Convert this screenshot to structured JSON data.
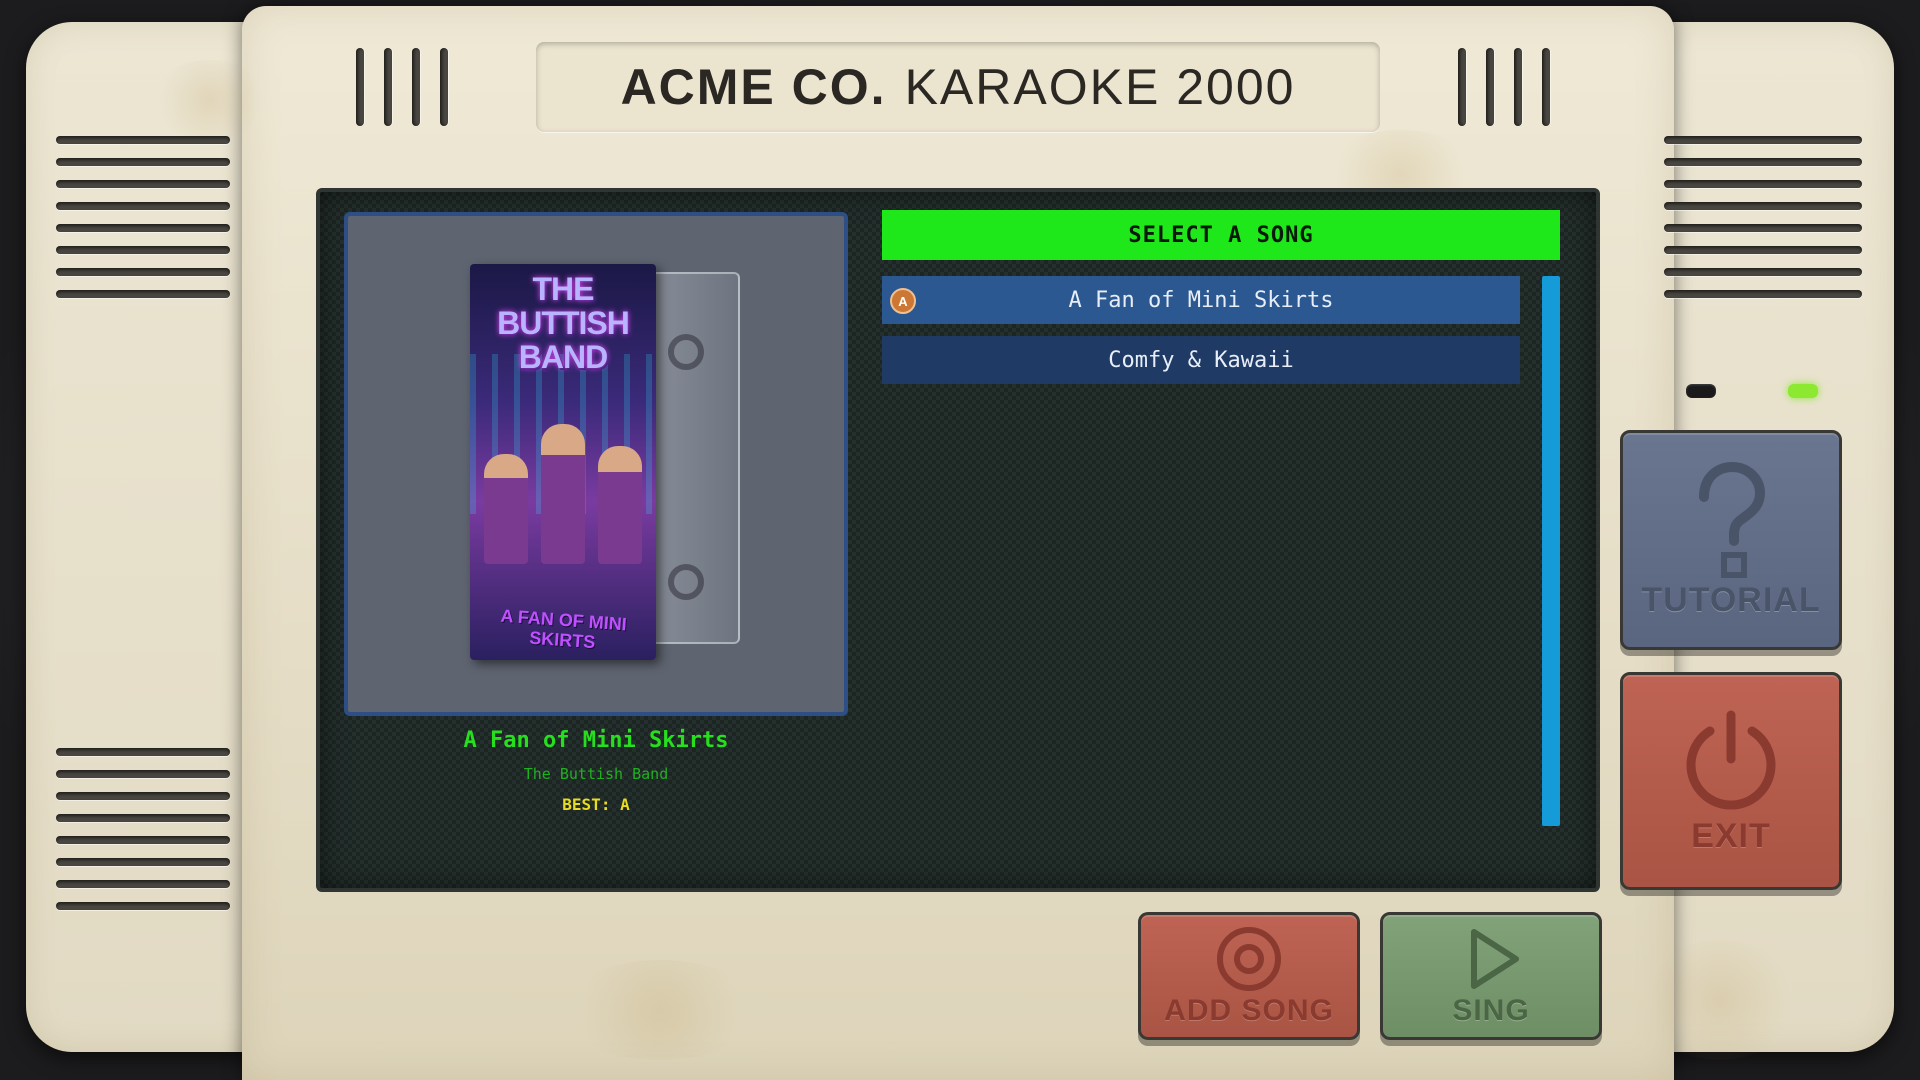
{
  "device": {
    "brand": "ACME CO.",
    "model": "KARAOKE 2000"
  },
  "now_playing": {
    "title": "A Fan of Mini Skirts",
    "artist": "The Buttish Band",
    "best": "BEST: A",
    "cover": {
      "title": "THE BUTTISH BAND",
      "subtitle": "A FAN OF MINI SKIRTS"
    }
  },
  "song_list": {
    "header": "SELECT A SONG",
    "songs": [
      {
        "title": "A Fan of Mini Skirts",
        "grade": "A",
        "selected": true
      },
      {
        "title": "Comfy & Kawaii",
        "grade": "",
        "selected": false
      }
    ]
  },
  "buttons": {
    "tutorial": "TUTORIAL",
    "exit": "EXIT",
    "add_song": "ADD SONG",
    "sing": "SING"
  },
  "icons": {
    "tutorial": "question-mark-icon",
    "exit": "power-icon",
    "add_song": "record-icon",
    "sing": "play-icon"
  },
  "indicators": {
    "led_left": "off",
    "led_right": "on"
  },
  "colors": {
    "header_green": "#1ee81a",
    "selected_row": "#2b5891",
    "row": "#1f3b65",
    "scrollbar": "#159bd8",
    "best_yellow": "#e8dc20"
  }
}
